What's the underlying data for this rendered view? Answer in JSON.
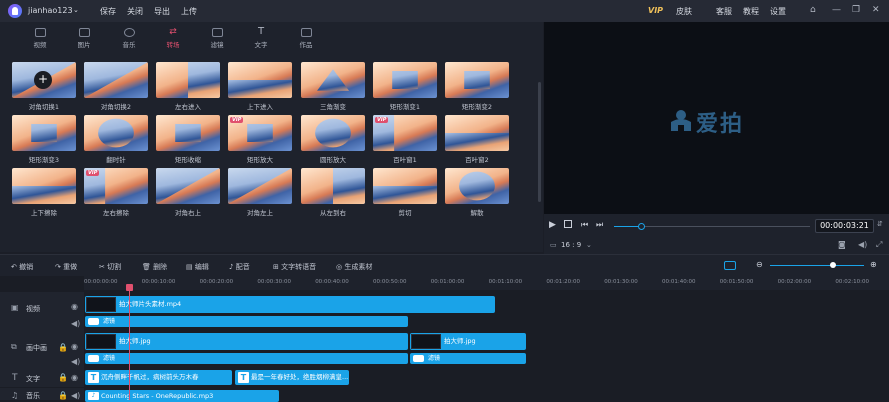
{
  "titlebar": {
    "username": "jianhao123",
    "menu": [
      "保存",
      "关闭",
      "导出",
      "上传"
    ],
    "vip_label": "VIP",
    "right_menu": [
      "皮肤",
      "客服",
      "教程",
      "设置"
    ]
  },
  "tabs": [
    {
      "label": "视频",
      "icon": "video-icon"
    },
    {
      "label": "图片",
      "icon": "image-icon"
    },
    {
      "label": "音乐",
      "icon": "music-icon"
    },
    {
      "label": "转场",
      "icon": "transition-icon",
      "active": true
    },
    {
      "label": "滤镜",
      "icon": "filter-icon"
    },
    {
      "label": "文字",
      "icon": "text-icon"
    },
    {
      "label": "作品",
      "icon": "works-icon"
    }
  ],
  "transitions": [
    [
      "对角切换1",
      "对角切换2",
      "左右进入",
      "上下进入",
      "三角渐变",
      "矩形渐变1",
      "矩形渐变2"
    ],
    [
      "矩形渐变3",
      "翻时针",
      "矩形收缩",
      "矩形放大",
      "圆形放大",
      "百叶窗1",
      "百叶窗2"
    ],
    [
      "上下擦除",
      "左右擦除",
      "对角右上",
      "对角左上",
      "从左到右",
      "剪切",
      "解散"
    ]
  ],
  "vip_badge": "VIP",
  "preview": {
    "brand": "爱拍",
    "timecode": "00:00:03:21",
    "aspect": "16 : 9"
  },
  "toolbar": [
    "撤销",
    "重做",
    "切割",
    "删除",
    "编辑",
    "配音",
    "文字转语音",
    "生成素材"
  ],
  "ruler": [
    "00:00:00:00",
    "00:00:10:00",
    "00:00:20:00",
    "00:00:30:00",
    "00:00:40:00",
    "00:00:50:00",
    "00:01:00:00",
    "00:01:10:00",
    "00:01:20:00",
    "00:01:30:00",
    "00:01:40:00",
    "00:01:50:00",
    "00:02:00:00",
    "00:02:10:00"
  ],
  "tracks": {
    "video_label": "视频",
    "pip_label": "画中画",
    "text_label": "文字",
    "music_label": "音乐"
  },
  "clips": {
    "video1": "拍大师片头素材.mp4",
    "filter": "滤镜",
    "pip1": "拍大师.jpg",
    "pip2": "拍大师.jpg",
    "text1": "沉舟侧畔千帆过，病树前头万木春",
    "text2": "最是一年春好处，绝胜烟柳满皇...",
    "music1": "Counting Stars - OneRepublic.mp3"
  },
  "colors": {
    "accent": "#e0506e",
    "clip_blue": "#1aa3e8",
    "vip_gold": "#f0c15a"
  }
}
